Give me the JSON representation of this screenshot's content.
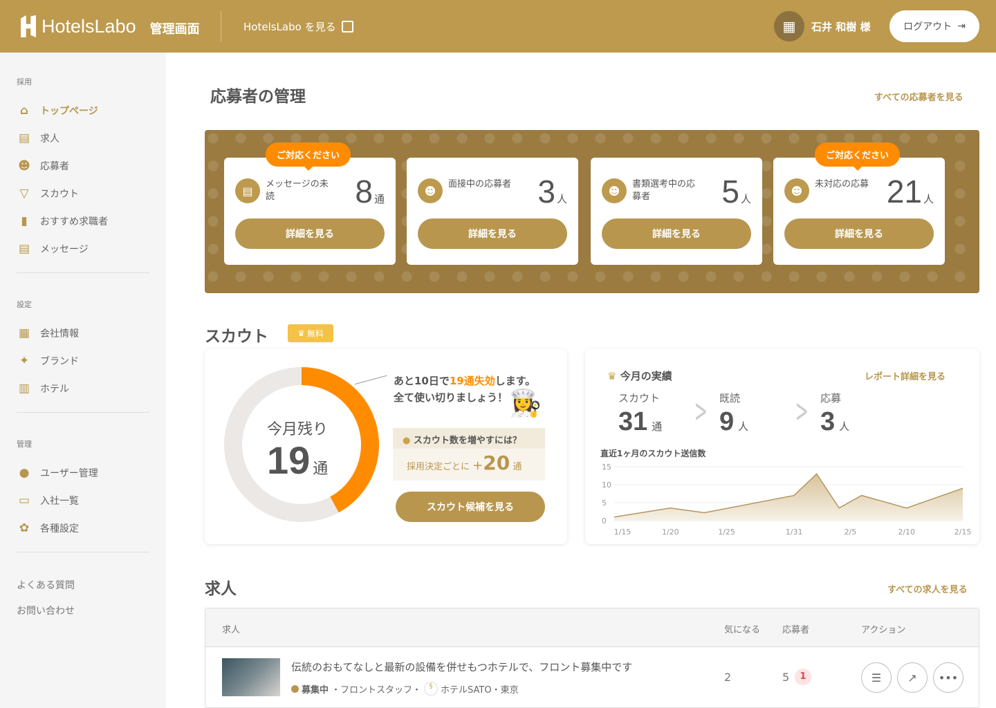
{
  "header": {
    "logo": "HotelsLabo",
    "subtitle": "管理画面",
    "site_link": "HotelsLabo を見る",
    "user": "石井 和樹 様",
    "logout": "ログアウト"
  },
  "sidebar": {
    "sections": [
      {
        "label": "採用",
        "items": [
          {
            "label": "トップページ",
            "icon": "home-icon"
          },
          {
            "label": "求人",
            "icon": "document-icon"
          },
          {
            "label": "応募者",
            "icon": "users-icon"
          },
          {
            "label": "スカウト",
            "icon": "send-icon"
          },
          {
            "label": "おすすめ求職者",
            "icon": "bookmark-icon"
          },
          {
            "label": "メッセージ",
            "icon": "message-icon"
          }
        ]
      },
      {
        "label": "設定",
        "items": [
          {
            "label": "会社情報",
            "icon": "building-icon"
          },
          {
            "label": "ブランド",
            "icon": "sparkle-icon"
          },
          {
            "label": "ホテル",
            "icon": "hotel-icon"
          }
        ]
      },
      {
        "label": "管理",
        "items": [
          {
            "label": "ユーザー管理",
            "icon": "user-icon"
          },
          {
            "label": "入社一覧",
            "icon": "folder-icon"
          },
          {
            "label": "各種設定",
            "icon": "gear-icon"
          }
        ]
      }
    ],
    "footer": [
      "よくある質問",
      "お問い合わせ"
    ]
  },
  "applicants": {
    "title": "応募者の管理",
    "view_all": "すべての応募者を見る",
    "badge": "ご対応ください",
    "button": "詳細を見る",
    "cards": [
      {
        "label": "メッセージの未読",
        "value": "8",
        "unit": "通"
      },
      {
        "label": "面接中の応募者",
        "value": "3",
        "unit": "人"
      },
      {
        "label": "書類選考中の応募者",
        "value": "5",
        "unit": "人"
      },
      {
        "label": "未対応の応募",
        "value": "21",
        "unit": "人"
      }
    ]
  },
  "scout": {
    "title": "スカウト",
    "free": "無料",
    "remaining_label": "今月残り",
    "remaining": "19",
    "unit": "通",
    "remaining_fraction": 0.42,
    "notice_pre": "あと10日で",
    "notice_hl": "19通失効",
    "notice_post": "します。",
    "notice2": "全て使い切りましょう！",
    "tip_title": "スカウト数を増やすには？",
    "tip_text": "採用決定ごとに",
    "tip_plus": "+",
    "tip_num": "20",
    "tip_unit": "通",
    "button": "スカウト候補を見る",
    "results": {
      "title": "今月の実績",
      "report": "レポート詳細を見る",
      "items": [
        {
          "label": "スカウト",
          "value": "31",
          "unit": "通"
        },
        {
          "label": "既読",
          "value": "9",
          "unit": "人"
        },
        {
          "label": "応募",
          "value": "3",
          "unit": "人"
        }
      ]
    }
  },
  "chart_data": {
    "type": "area",
    "title": "直近1ヶ月のスカウト送信数",
    "x": [
      0,
      5,
      8,
      16,
      18,
      20,
      22,
      26,
      31
    ],
    "values": [
      1,
      3.5,
      2.2,
      7,
      13,
      3.5,
      7,
      3.5,
      9
    ],
    "x_ticks": [
      {
        "x": 0,
        "label": "1/15"
      },
      {
        "x": 5,
        "label": "1/20"
      },
      {
        "x": 10,
        "label": "1/25"
      },
      {
        "x": 16,
        "label": "1/31"
      },
      {
        "x": 21,
        "label": "2/5"
      },
      {
        "x": 26,
        "label": "2/10"
      },
      {
        "x": 31,
        "label": "2/15"
      }
    ],
    "y_ticks": [
      0,
      5,
      10,
      15
    ],
    "ylim": [
      0,
      15
    ],
    "xlim": [
      0,
      31
    ],
    "grid": true
  },
  "jobs": {
    "title": "求人",
    "view_all": "すべての求人を見る",
    "columns": [
      "求人",
      "気になる",
      "応募者",
      "アクション"
    ],
    "rows": [
      {
        "title": "伝統のおもてなしと最新の設備を併せもつホテルで、フロント募集中です",
        "status": "募集中",
        "meta": "・フロントスタッフ・",
        "hotel": "ホテルSATO・東京",
        "interested": "2",
        "applicants": "5",
        "new": "1"
      }
    ]
  },
  "colors": {
    "brand": "#bd9a4e",
    "accent": "#ff8c00"
  }
}
